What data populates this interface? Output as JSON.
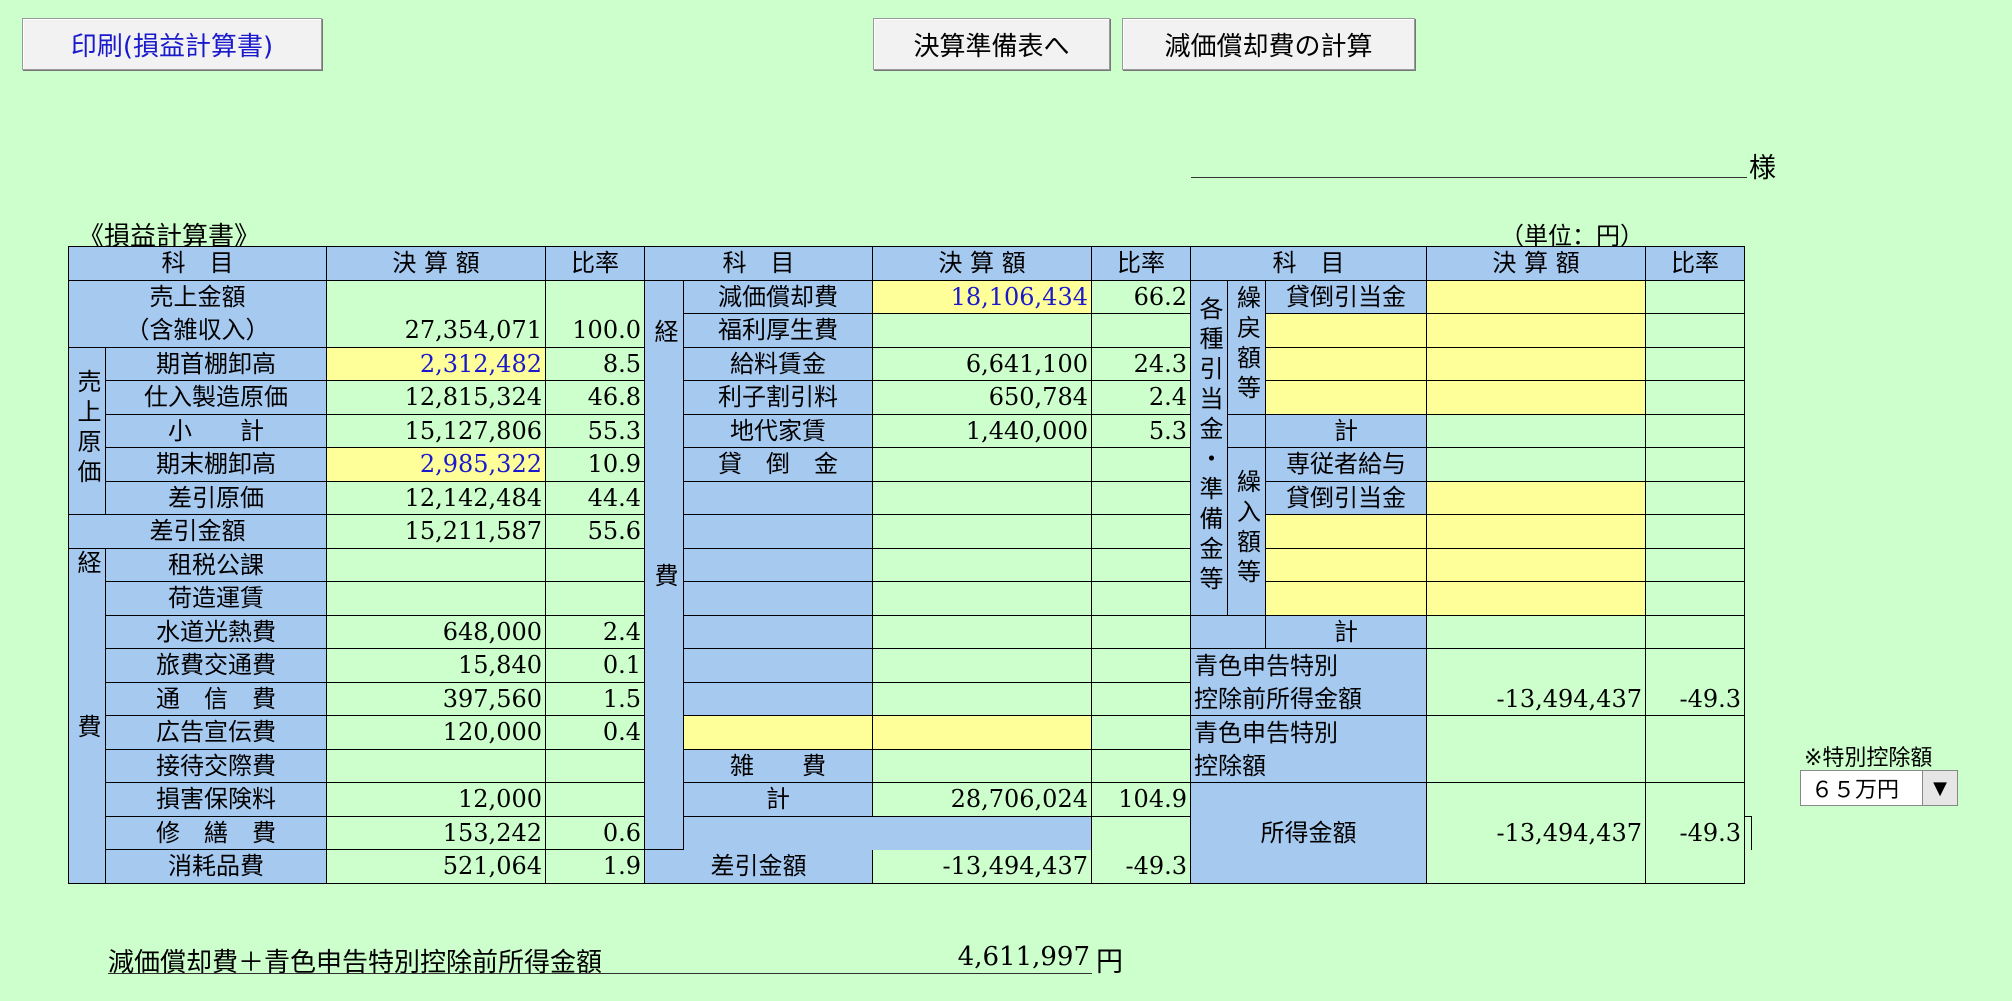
{
  "toolbar": {
    "print_label": "印刷(損益計算書)",
    "prep_label": "決算準備表へ",
    "depr_label": "減価償却費の計算"
  },
  "header": {
    "sama": "様",
    "title": "《損益計算書》",
    "unit": "（単位：円）"
  },
  "columns": {
    "subject": "科　目",
    "amount": "決 算 額",
    "ratio": "比率"
  },
  "left": {
    "sales_l1": "売上金額",
    "sales_l2": "（含雑収入）",
    "sales_amt": "27,354,071",
    "sales_ratio": "100.0",
    "cogs_group": "売上原価",
    "open_inv": "期首棚卸高",
    "open_inv_amt": "2,312,482",
    "open_inv_ratio": "8.5",
    "purchase": "仕入製造原価",
    "purchase_amt": "12,815,324",
    "purchase_ratio": "46.8",
    "subtotal": "小　　計",
    "subtotal_amt": "15,127,806",
    "subtotal_ratio": "55.3",
    "close_inv": "期末棚卸高",
    "close_inv_amt": "2,985,322",
    "close_inv_ratio": "10.9",
    "net_cogs": "差引原価",
    "net_cogs_amt": "12,142,484",
    "net_cogs_ratio": "44.4",
    "gross": "差引金額",
    "gross_amt": "15,211,587",
    "gross_ratio": "55.6",
    "exp_group": "経費",
    "tax": "租税公課",
    "freight": "荷造運賃",
    "utility": "水道光熱費",
    "utility_amt": "648,000",
    "utility_ratio": "2.4",
    "travel": "旅費交通費",
    "travel_amt": "15,840",
    "travel_ratio": "0.1",
    "comm": "通　信　費",
    "comm_amt": "397,560",
    "comm_ratio": "1.5",
    "ad": "広告宣伝費",
    "ad_amt": "120,000",
    "ad_ratio": "0.4",
    "enter": "接待交際費",
    "insure": "損害保険料",
    "insure_amt": "12,000",
    "repair": "修　繕　費",
    "repair_amt": "153,242",
    "repair_ratio": "0.6",
    "supplies": "消耗品費",
    "supplies_amt": "521,064",
    "supplies_ratio": "1.9"
  },
  "middle": {
    "exp_group": "経費",
    "depr": "減価償却費",
    "depr_amt": "18,106,434",
    "depr_ratio": "66.2",
    "welfare": "福利厚生費",
    "salary": "給料賃金",
    "salary_amt": "6,641,100",
    "salary_ratio": "24.3",
    "interest": "利子割引料",
    "interest_amt": "650,784",
    "interest_ratio": "2.4",
    "rent": "地代家賃",
    "rent_amt": "1,440,000",
    "rent_ratio": "5.3",
    "baddebt": "貸　倒　金",
    "misc": "雑　　費",
    "total": "計",
    "total_amt": "28,706,024",
    "total_ratio": "104.9",
    "net": "差引金額",
    "net_amt": "-13,494,437",
    "net_ratio": "-49.3"
  },
  "right": {
    "reserve_group": "各種引当金・準備金等",
    "reversal_group": "繰戻額等",
    "transfer_group": "繰入額等",
    "rev_allow": "貸倒引当金",
    "rev_total": "計",
    "family_wage": "専従者給与",
    "tr_allow": "貸倒引当金",
    "tr_total": "計",
    "blue_pre_l1": "青色申告特別",
    "blue_pre_l2": "控除前所得金額",
    "blue_pre_amt": "-13,494,437",
    "blue_pre_ratio": "-49.3",
    "blue_ded_l1": "青色申告特別",
    "blue_ded_l2": "控除額",
    "income": "所得金額",
    "income_amt": "-13,494,437",
    "income_ratio": "-49.3"
  },
  "special": {
    "note": "※特別控除額",
    "value": "６５万円"
  },
  "footer": {
    "label": "減価償却費＋青色申告特別控除前所得金額",
    "value": "4,611,997",
    "unit": "円"
  }
}
